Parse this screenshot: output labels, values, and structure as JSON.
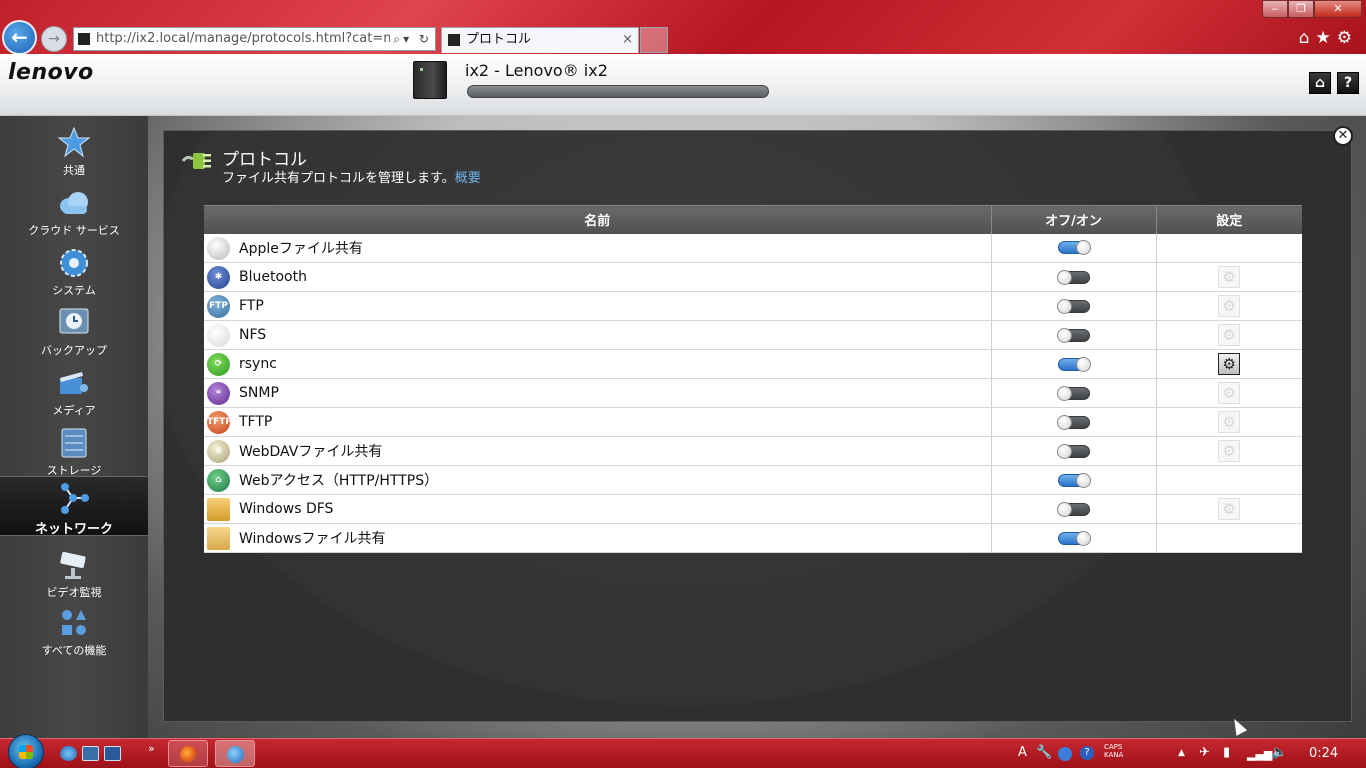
{
  "browser": {
    "url": "http://ix2.local/manage/protocols.html?cat=n",
    "tab_title": "プロトコル",
    "tab_close": "×",
    "min": "‒",
    "max": "❐",
    "close": "✕"
  },
  "header": {
    "logo": "lenovo",
    "device_title": "ix2 - Lenovo® ix2"
  },
  "sidebar": {
    "items": [
      {
        "label": "共通"
      },
      {
        "label": "クラウド サービス"
      },
      {
        "label": "システム"
      },
      {
        "label": "バックアップ"
      },
      {
        "label": "メディア"
      },
      {
        "label": "ストレージ"
      },
      {
        "label": "ネットワーク"
      },
      {
        "label": "ビデオ監視"
      },
      {
        "label": "すべての機能"
      }
    ]
  },
  "page": {
    "title": "プロトコル",
    "description": "ファイル共有プロトコルを管理します。",
    "overview_link": "概要"
  },
  "table": {
    "headers": {
      "name": "名前",
      "toggle": "オフ/オン",
      "settings": "設定"
    },
    "rows": [
      {
        "name": "Appleファイル共有",
        "on": true,
        "settings": "none"
      },
      {
        "name": "Bluetooth",
        "on": false,
        "settings": "disabled"
      },
      {
        "name": "FTP",
        "on": false,
        "settings": "disabled"
      },
      {
        "name": "NFS",
        "on": false,
        "settings": "disabled"
      },
      {
        "name": "rsync",
        "on": true,
        "settings": "enabled"
      },
      {
        "name": "SNMP",
        "on": false,
        "settings": "disabled"
      },
      {
        "name": "TFTP",
        "on": false,
        "settings": "disabled"
      },
      {
        "name": "WebDAVファイル共有",
        "on": false,
        "settings": "disabled"
      },
      {
        "name": "Webアクセス（HTTP/HTTPS）",
        "on": true,
        "settings": "none"
      },
      {
        "name": "Windows DFS",
        "on": false,
        "settings": "disabled"
      },
      {
        "name": "Windowsファイル共有",
        "on": true,
        "settings": "none"
      }
    ]
  },
  "taskbar": {
    "clock": "0:24",
    "caps": "CAPS",
    "kana": "KANA",
    "ime": "A"
  },
  "colors": {
    "accent_red": "#c0202a",
    "toggle_on": "#2b73c8",
    "link_blue": "#6cb3ea"
  }
}
